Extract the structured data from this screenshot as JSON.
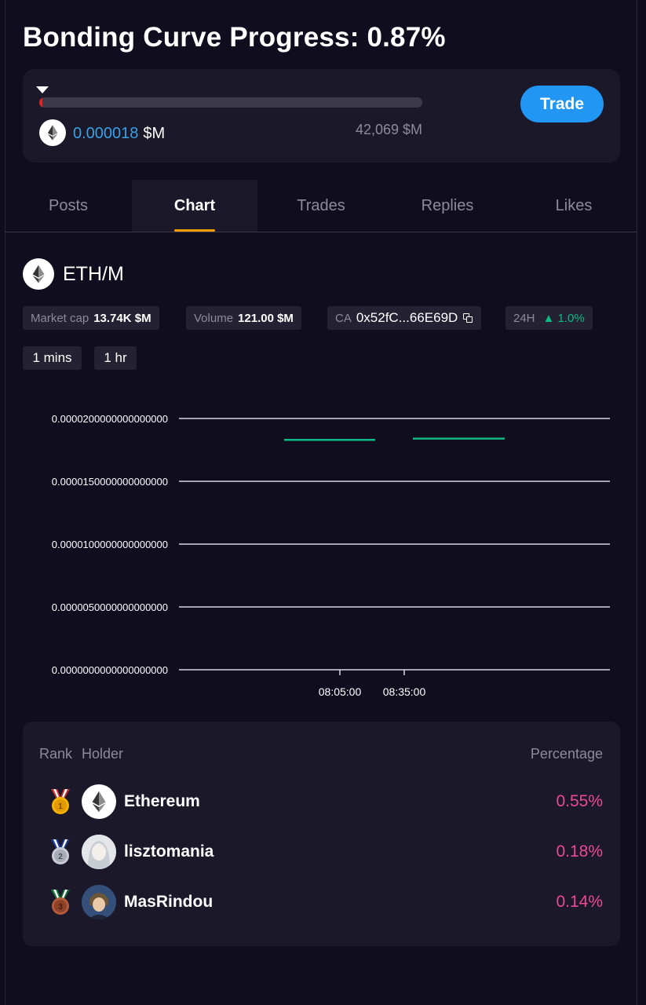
{
  "header": {
    "title": "Bonding Curve Progress: 0.87%"
  },
  "bonding_curve": {
    "progress_fraction": 0.0087,
    "current_value": "0.000018",
    "current_unit": "$M",
    "target_label": "42,069 $M",
    "trade_label": "Trade",
    "colors": {
      "fill": "#e02424",
      "accent": "#2196f3"
    }
  },
  "tabs": [
    {
      "label": "Posts"
    },
    {
      "label": "Chart",
      "active": true
    },
    {
      "label": "Trades"
    },
    {
      "label": "Replies"
    },
    {
      "label": "Likes"
    }
  ],
  "token": {
    "pair": "ETH/M",
    "icon": "ethereum-icon",
    "stats": {
      "market_cap_label": "Market cap",
      "market_cap_value": "13.74K $M",
      "volume_label": "Volume",
      "volume_value": "121.00 $M",
      "ca_label": "CA",
      "ca_value": "0x52fC...66E69D",
      "change_label": "24H",
      "change_value": "1.0%",
      "change_color": "#10b981"
    },
    "intervals": [
      "1 mins",
      "1 hr"
    ]
  },
  "chart_data": {
    "type": "line",
    "title": "",
    "xlabel": "",
    "ylabel": "",
    "ylim": [
      0,
      2e-05
    ],
    "y_ticks": [
      "0.0000200000000000000",
      "0.0000150000000000000",
      "0.0000100000000000000",
      "0.0000050000000000000",
      "0.0000000000000000000"
    ],
    "x_ticks": [
      "08:05:00",
      "08:35:00"
    ],
    "series": [
      {
        "values": [
          1.83e-05,
          1.83e-05
        ],
        "color": "#10b981"
      },
      {
        "values": [
          1.84e-05,
          1.84e-05
        ],
        "color": "#10b981"
      }
    ],
    "grid": true
  },
  "holders": {
    "rank_header": "Rank",
    "holder_header": "Holder",
    "percentage_header": "Percentage",
    "rows": [
      {
        "rank": 1,
        "name": "Ethereum",
        "percentage": "0.55%",
        "medal": "gold-medal-icon",
        "avatar": "ethereum-avatar"
      },
      {
        "rank": 2,
        "name": "lisztomania",
        "percentage": "0.18%",
        "medal": "silver-medal-icon",
        "avatar": "anime-character-avatar"
      },
      {
        "rank": 3,
        "name": "MasRindou",
        "percentage": "0.14%",
        "medal": "bronze-medal-icon",
        "avatar": "anime-character-avatar"
      }
    ]
  }
}
